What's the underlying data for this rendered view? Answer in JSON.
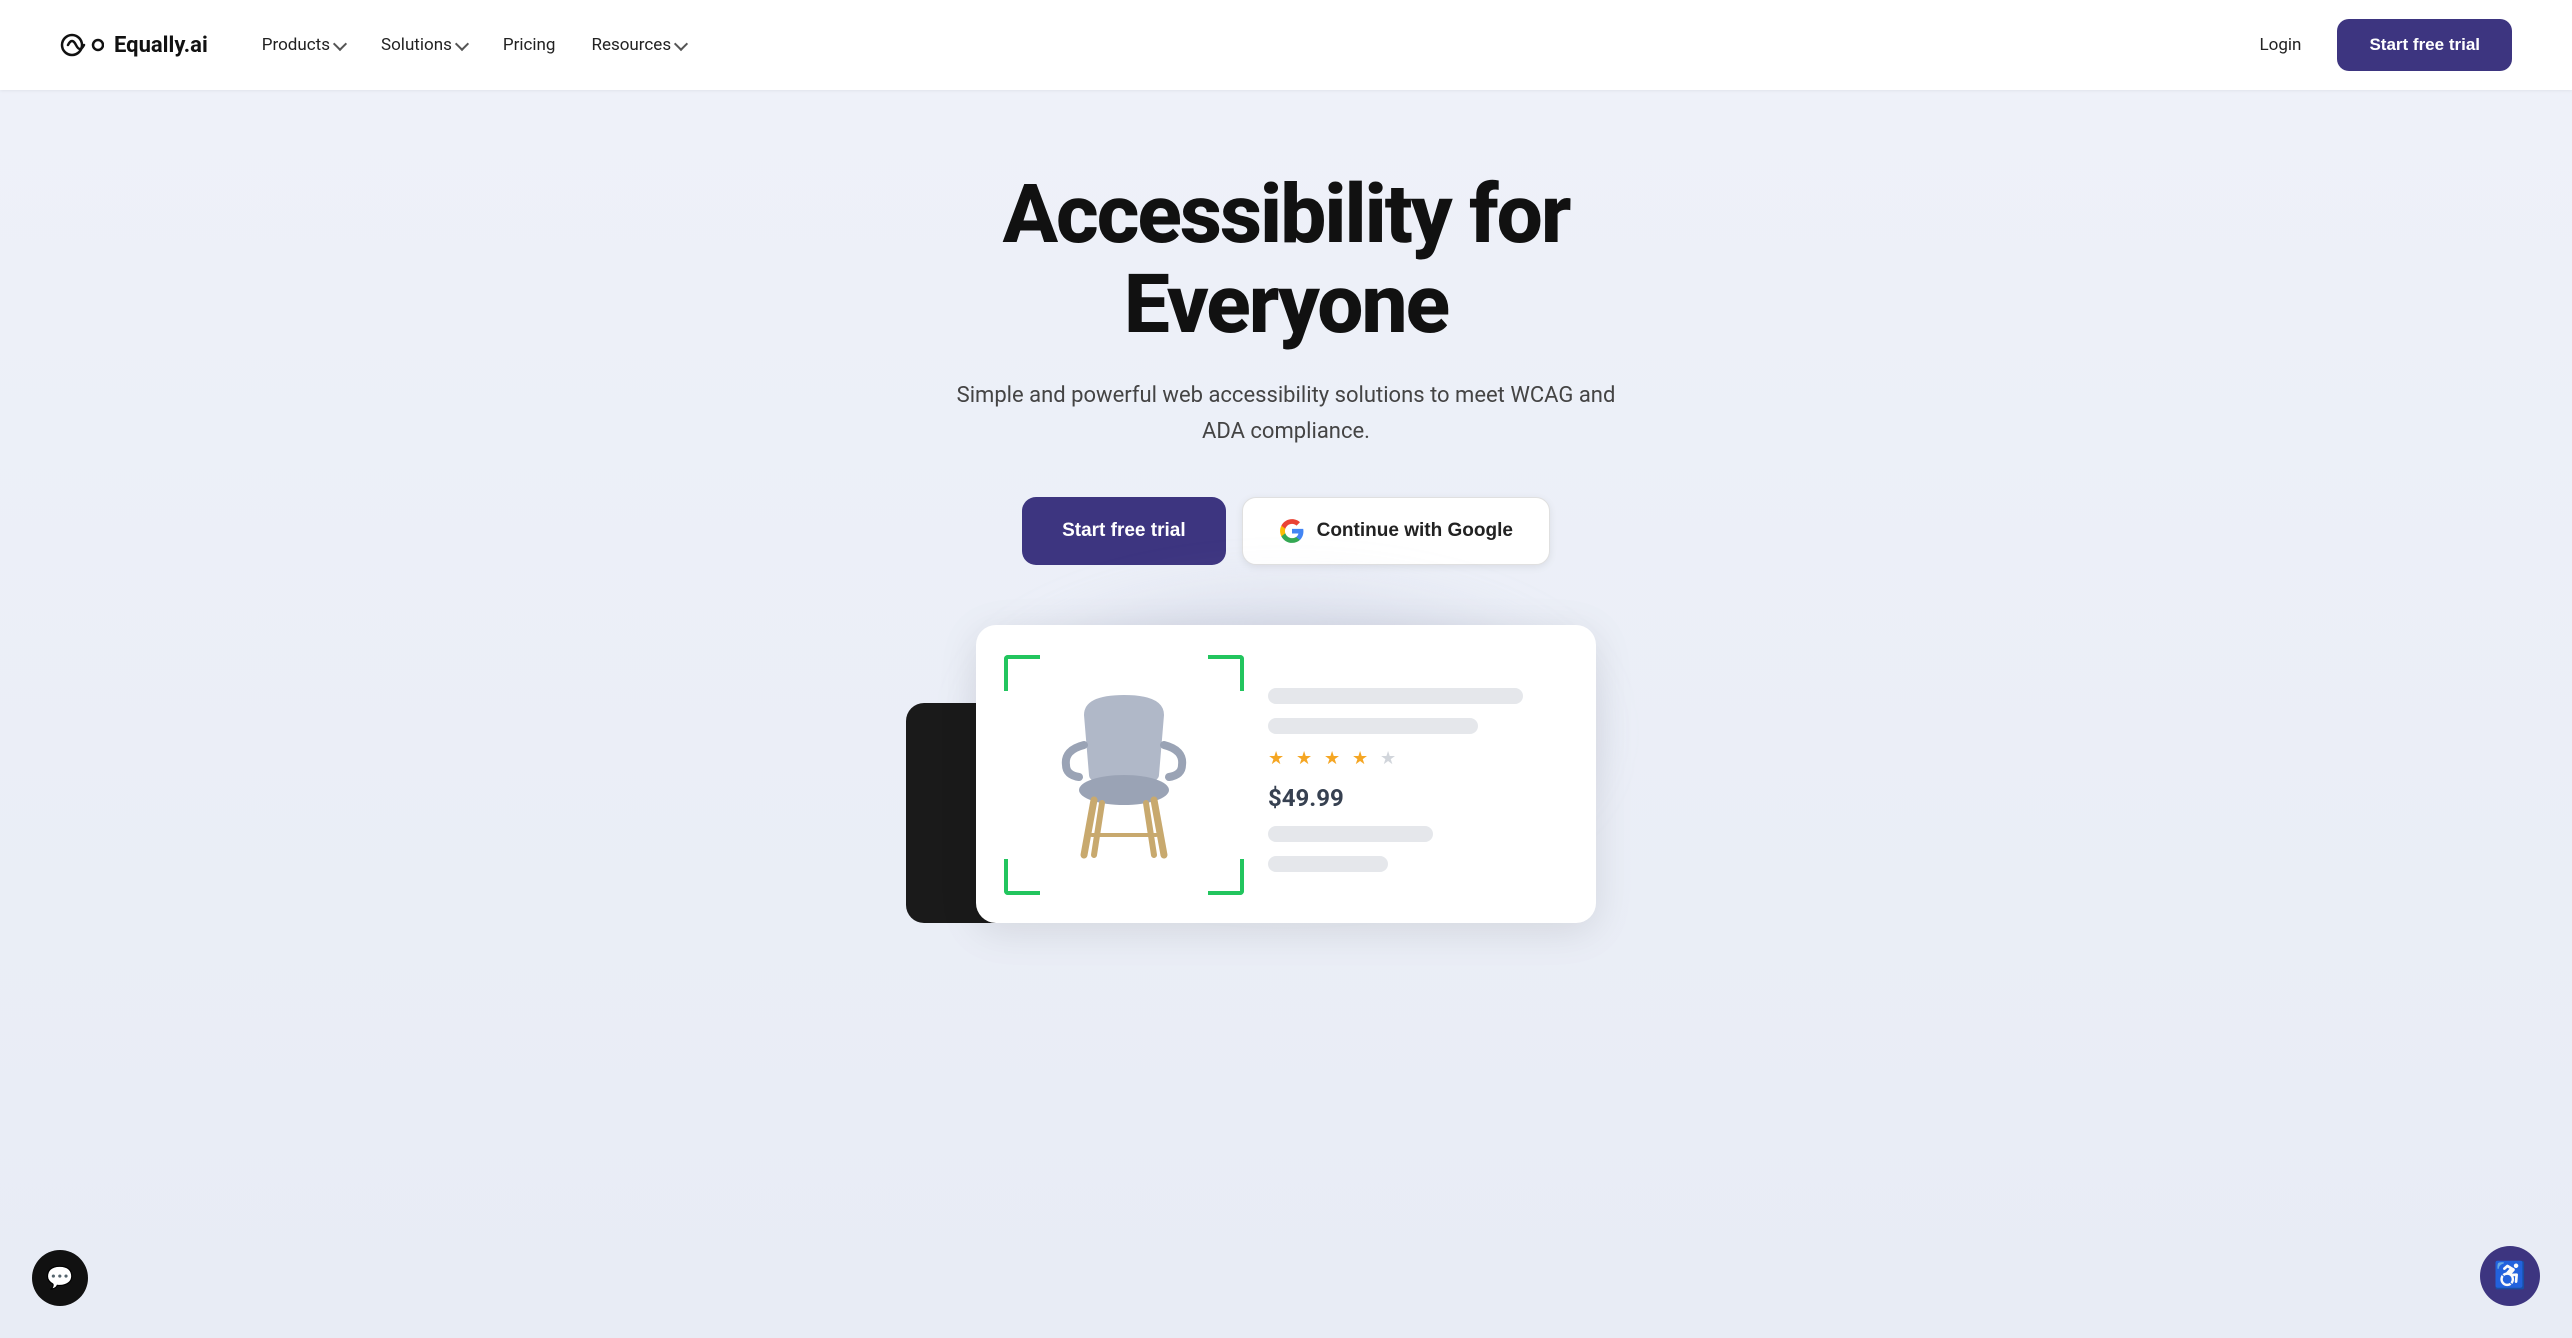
{
  "brand": {
    "name": "Equally.ai",
    "logo_alt": "Equally.ai logo"
  },
  "navbar": {
    "products_label": "Products",
    "solutions_label": "Solutions",
    "pricing_label": "Pricing",
    "resources_label": "Resources",
    "login_label": "Login",
    "trial_label": "Start free trial"
  },
  "hero": {
    "title": "Accessibility for Everyone",
    "subtitle": "Simple and powerful web accessibility solutions to meet WCAG and ADA compliance.",
    "cta_primary": "Start free trial",
    "cta_google": "Continue with Google"
  },
  "product_card": {
    "price": "$49.99",
    "stars_filled": 4,
    "stars_total": 5
  },
  "widgets": {
    "chat_label": "Chat",
    "a11y_label": "Accessibility"
  }
}
